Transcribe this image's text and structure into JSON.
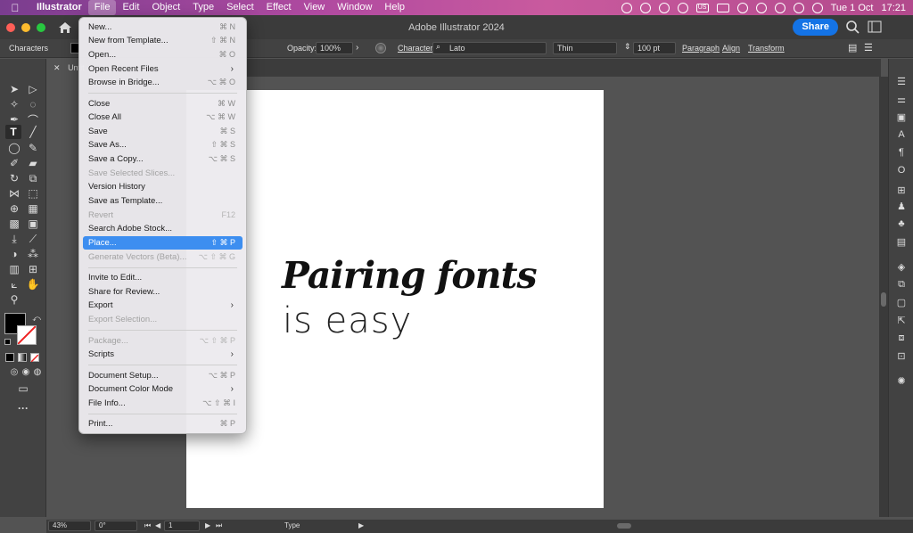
{
  "menubar": {
    "app": "Illustrator",
    "menus": [
      "File",
      "Edit",
      "Object",
      "Type",
      "Select",
      "Effect",
      "View",
      "Window",
      "Help"
    ],
    "date": "Tue 1 Oct",
    "time": "17:21",
    "flag": "US"
  },
  "window": {
    "title": "Adobe Illustrator 2024",
    "share": "Share"
  },
  "control": {
    "panel_label": "Characters",
    "opacity_label": "Opacity:",
    "opacity_value": "100%",
    "character_label": "Character:",
    "font": "Lato",
    "style": "Thin",
    "size": "100 pt",
    "paragraph": "Paragraph",
    "align": "Align",
    "transform": "Transform"
  },
  "doc": {
    "tab": "Untit"
  },
  "artboard": {
    "line1": "Pairing fonts",
    "line2": "is easy"
  },
  "status": {
    "zoom": "43%",
    "rotate": "0°",
    "artboard": "1",
    "tool": "Type"
  },
  "file_menu": {
    "items": [
      {
        "label": "New...",
        "shortcut": "⌘ N"
      },
      {
        "label": "New from Template...",
        "shortcut": "⇧ ⌘ N"
      },
      {
        "label": "Open...",
        "shortcut": "⌘ O"
      },
      {
        "label": "Open Recent Files",
        "shortcut": ""
      },
      {
        "label": "Browse in Bridge...",
        "shortcut": "⌥ ⌘ O"
      },
      {
        "label": "Close",
        "shortcut": "⌘ W"
      },
      {
        "label": "Close All",
        "shortcut": "⌥ ⌘ W"
      },
      {
        "label": "Save",
        "shortcut": "⌘ S"
      },
      {
        "label": "Save As...",
        "shortcut": "⇧ ⌘ S"
      },
      {
        "label": "Save a Copy...",
        "shortcut": "⌥ ⌘ S"
      },
      {
        "label": "Save Selected Slices...",
        "shortcut": ""
      },
      {
        "label": "Version History",
        "shortcut": ""
      },
      {
        "label": "Save as Template...",
        "shortcut": ""
      },
      {
        "label": "Revert",
        "shortcut": "F12"
      },
      {
        "label": "Search Adobe Stock...",
        "shortcut": ""
      },
      {
        "label": "Place...",
        "shortcut": "⇧ ⌘ P"
      },
      {
        "label": "Generate Vectors (Beta)...",
        "shortcut": "⌥ ⇧ ⌘ G"
      },
      {
        "label": "Invite to Edit...",
        "shortcut": ""
      },
      {
        "label": "Share for Review...",
        "shortcut": ""
      },
      {
        "label": "Export",
        "shortcut": ""
      },
      {
        "label": "Export Selection...",
        "shortcut": ""
      },
      {
        "label": "Package...",
        "shortcut": "⌥ ⇧ ⌘ P"
      },
      {
        "label": "Scripts",
        "shortcut": ""
      },
      {
        "label": "Document Setup...",
        "shortcut": "⌥ ⌘ P"
      },
      {
        "label": "Document Color Mode",
        "shortcut": ""
      },
      {
        "label": "File Info...",
        "shortcut": "⌥ ⇧ ⌘ I"
      },
      {
        "label": "Print...",
        "shortcut": "⌘ P"
      }
    ]
  },
  "colors": {
    "accent": "#1473e6",
    "menu_highlight": "#3d8ef0",
    "canvas": "#535353"
  }
}
